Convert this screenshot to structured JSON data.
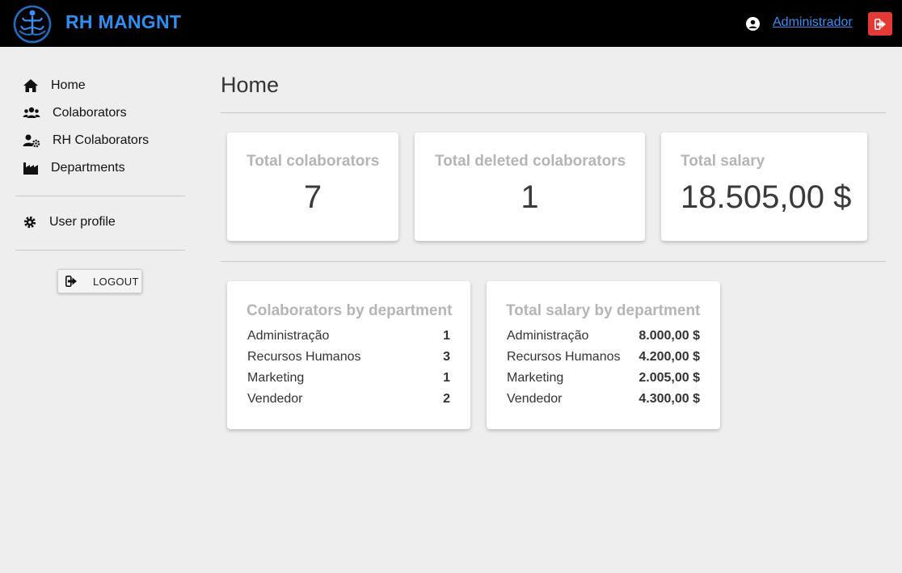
{
  "header": {
    "brand": "RH MANGNT",
    "user_name": "Administrador",
    "logo_icon": "tree-logo-icon",
    "user_icon": "user-circle-icon",
    "exit_icon": "sign-out-icon",
    "brand_color": "#2f8ff0",
    "exit_color": "#e53935"
  },
  "sidebar": {
    "items": [
      {
        "label": "Home",
        "icon": "home-icon"
      },
      {
        "label": "Colaborators",
        "icon": "users-icon"
      },
      {
        "label": "RH Colaborators",
        "icon": "user-cog-icon"
      },
      {
        "label": "Departments",
        "icon": "industry-icon"
      }
    ],
    "profile": {
      "label": "User profile",
      "icon": "gear-icon"
    },
    "logout_label": "LOGOUT"
  },
  "main": {
    "title": "Home",
    "stats": [
      {
        "title": "Total colaborators",
        "value": "7"
      },
      {
        "title": "Total deleted colaborators",
        "value": "1"
      },
      {
        "title": "Total salary",
        "value": "18.505,00 $"
      }
    ],
    "by_department": {
      "title": "Colaborators by department",
      "rows": [
        {
          "name": "Administração",
          "value": "1"
        },
        {
          "name": "Recursos Humanos",
          "value": "3"
        },
        {
          "name": "Marketing",
          "value": "1"
        },
        {
          "name": "Vendedor",
          "value": "2"
        }
      ]
    },
    "salary_by_department": {
      "title": "Total salary by department",
      "rows": [
        {
          "name": "Administração",
          "value": "8.000,00 $"
        },
        {
          "name": "Recursos Humanos",
          "value": "4.200,00 $"
        },
        {
          "name": "Marketing",
          "value": "2.005,00 $"
        },
        {
          "name": "Vendedor",
          "value": "4.300,00 $"
        }
      ]
    }
  }
}
